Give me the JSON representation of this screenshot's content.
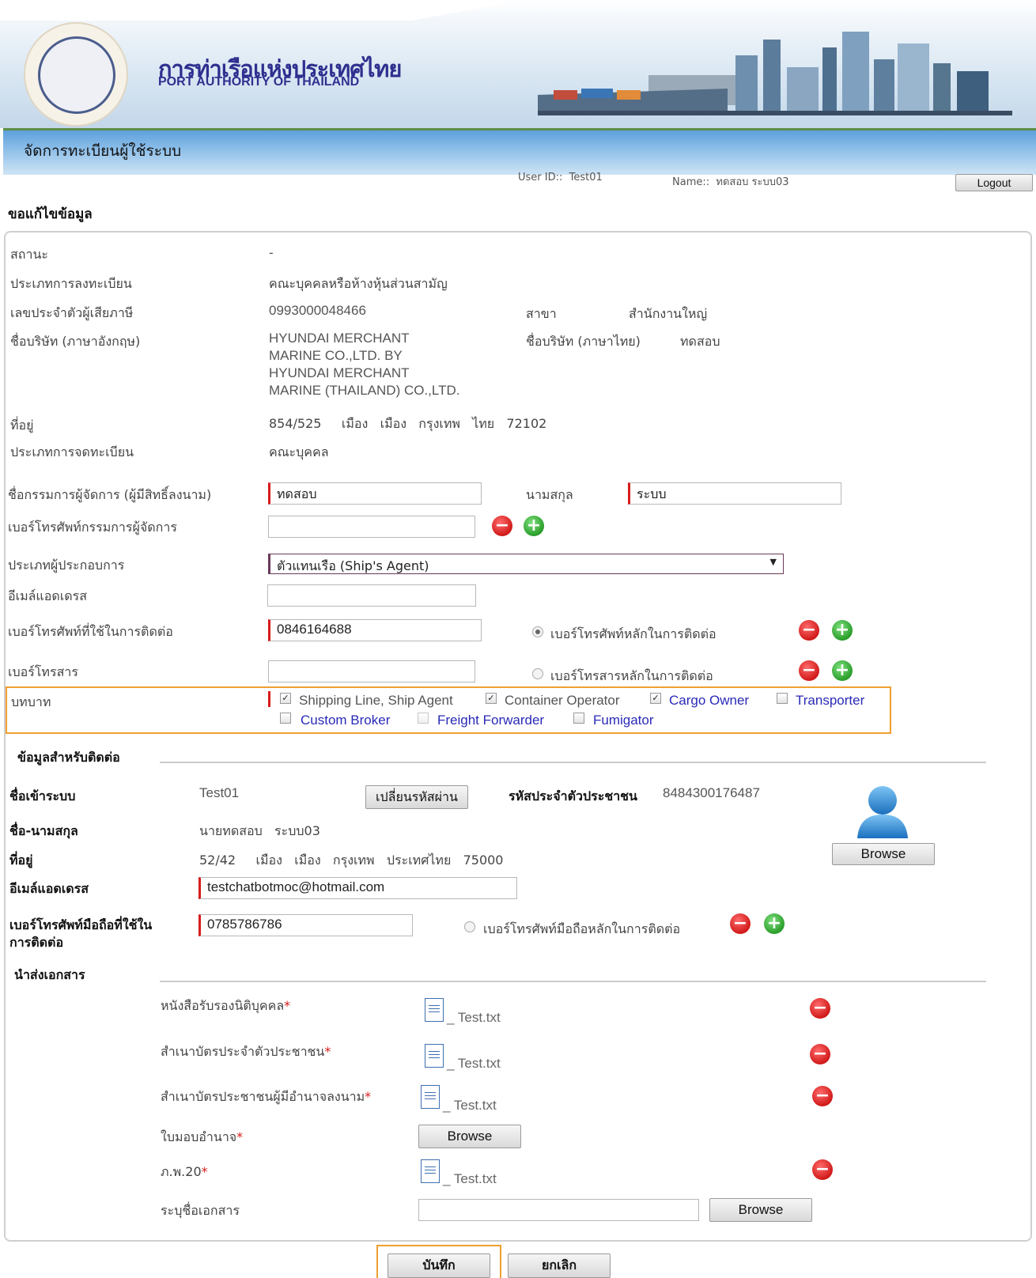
{
  "header": {
    "logo_th": "การท่าเรือแห่งประเทศไทย",
    "logo_en": "PORT AUTHORITY OF THAILAND",
    "page_title": "จัดการทะเบียนผู้ใช้ระบบ",
    "user_id": "User ID::  Test01",
    "user_name": "Name::  ทดสอบ ระบบ03",
    "logout": "Logout"
  },
  "section_title": "ขอแก้ไขข้อมูล",
  "company": {
    "status_label": "สถานะ",
    "status_value": "-",
    "reg_type_label": "ประเภทการลงทะเบียน",
    "reg_type_value": "คณะบุคคลหรือห้างหุ้นส่วนสามัญ",
    "tax_id_label": "เลขประจำตัวผู้เสียภาษี",
    "tax_id_value": "0993000048466",
    "branch_label": "สาขา",
    "branch_value": "สำนักงานใหญ่",
    "name_en_label": "ชื่อบริษัท (ภาษาอังกฤษ)",
    "name_en_lines": [
      "HYUNDAI MERCHANT",
      "MARINE CO.,LTD. BY",
      "HYUNDAI MERCHANT",
      "MARINE (THAILAND) CO.,LTD."
    ],
    "name_th_label": "ชื่อบริษัท (ภาษาไทย)",
    "name_th_value": "ทดสอบ",
    "address_label": "ที่อยู่",
    "address_value": "854/525     เมือง   เมือง   กรุงเทพ   ไทย   72102",
    "reg_kind_label": "ประเภทการจดทะเบียน",
    "reg_kind_value": "คณะบุคคล",
    "director_label": "ชื่อกรรมการผู้จัดการ (ผู้มีสิทธิ์ลงนาม)",
    "director_first": "ทดสอบ",
    "surname_label": "นามสกุล",
    "director_last": "ระบบ",
    "director_phone_label": "เบอร์โทรศัพท์กรรมการผู้จัดการ",
    "director_phone": "",
    "operator_type_label": "ประเภทผู้ประกอบการ",
    "operator_type_value": "ตัวแทนเรือ (Ship's Agent)",
    "email_label": "อีเมล์แอดเดรส",
    "email_value": "",
    "contact_phone_label": "เบอร์โทรศัพท์ที่ใช้ในการติดต่อ",
    "contact_phone": "0846164688",
    "main_phone_radio": "เบอร์โทรศัพท์หลักในการติดต่อ",
    "fax_label": "เบอร์โทรสาร",
    "fax_value": "",
    "main_fax_radio": "เบอร์โทรสารหลักในการติดต่อ",
    "role_label": "บทบาท",
    "roles": [
      {
        "label": "Shipping Line, Ship Agent",
        "checked": true
      },
      {
        "label": "Container Operator",
        "checked": true
      },
      {
        "label": "Cargo Owner",
        "checked": true
      },
      {
        "label": "Transporter",
        "checked": false
      },
      {
        "label": "Custom Broker",
        "checked": false
      },
      {
        "label": "Freight Forwarder",
        "checked": false
      },
      {
        "label": "Fumigator",
        "checked": false
      }
    ]
  },
  "contact": {
    "title": "ข้อมูลสำหรับติดต่อ",
    "login_label": "ชื่อเข้าระบบ",
    "login_value": "Test01",
    "change_pwd": "เปลี่ยนรหัสผ่าน",
    "citizen_id_label": "รหัสประจำตัวประชาชน",
    "citizen_id_value": "8484300176487",
    "fullname_label": "ชื่อ-นามสกุล",
    "fullname_value": "นายทดสอบ   ระบบ03",
    "address_label": "ที่อยู่",
    "address_value": "52/42     เมือง   เมือง   กรุงเทพ   ประเทศไทย   75000",
    "email_label": "อีเมล์แอดเดรส",
    "email_value": "testchatbotmoc@hotmail.com",
    "mobile_label_1": "เบอร์โทรศัพท์มือถือที่ใช้ใน",
    "mobile_label_2": "การติดต่อ",
    "mobile_value": "0785786786",
    "main_mobile_radio": "เบอร์โทรศัพท์มือถือหลักในการติดต่อ",
    "browse": "Browse"
  },
  "documents": {
    "title": "นำส่งเอกสาร",
    "items": [
      {
        "label": "หนังสือรับรองนิติบุคคล",
        "file": "Test.txt"
      },
      {
        "label": "สำเนาบัตรประจำตัวประชาชน",
        "file": "Test.txt"
      },
      {
        "label": "สำเนาบัตรประชาชนผู้มีอำนาจลงนาม",
        "file": "Test.txt"
      },
      {
        "label": "ใบมอบอำนาจ",
        "file": ""
      },
      {
        "label": "ภ.พ.20",
        "file": "Test.txt"
      }
    ],
    "asterisk": "*",
    "browse": "Browse",
    "other_label": "ระบุชื่อเอกสาร",
    "other_value": ""
  },
  "actions": {
    "save": "บันทึก",
    "cancel": "ยกเลิก"
  },
  "colors": {
    "required": "#d81b1b",
    "highlight": "#f0a030",
    "link_blue": "#2a2ab8"
  }
}
